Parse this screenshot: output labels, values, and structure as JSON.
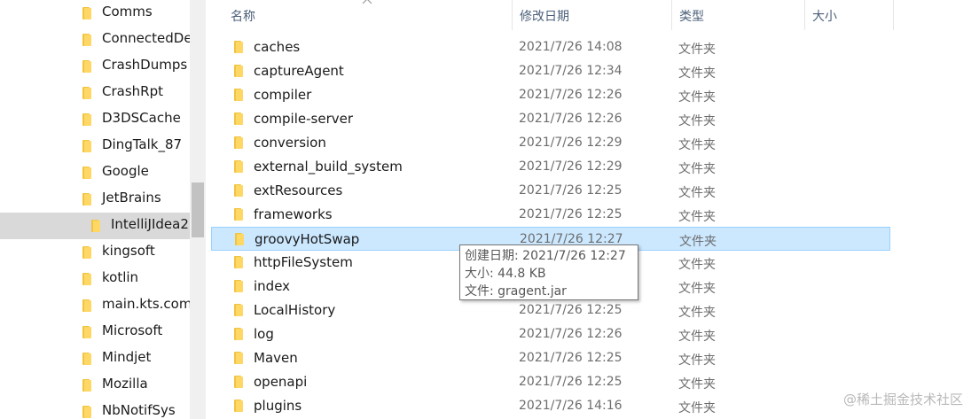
{
  "nav": {
    "items": [
      {
        "label": "Comms",
        "selected": false,
        "child": false
      },
      {
        "label": "ConnectedDe",
        "selected": false,
        "child": false
      },
      {
        "label": "CrashDumps",
        "selected": false,
        "child": false
      },
      {
        "label": "CrashRpt",
        "selected": false,
        "child": false
      },
      {
        "label": "D3DSCache",
        "selected": false,
        "child": false
      },
      {
        "label": "DingTalk_87",
        "selected": false,
        "child": false
      },
      {
        "label": "Google",
        "selected": false,
        "child": false
      },
      {
        "label": "JetBrains",
        "selected": false,
        "child": false
      },
      {
        "label": "IntelliJIdea2",
        "selected": true,
        "child": true
      },
      {
        "label": "kingsoft",
        "selected": false,
        "child": false
      },
      {
        "label": "kotlin",
        "selected": false,
        "child": false
      },
      {
        "label": "main.kts.com",
        "selected": false,
        "child": false
      },
      {
        "label": "Microsoft",
        "selected": false,
        "child": false
      },
      {
        "label": "Mindjet",
        "selected": false,
        "child": false
      },
      {
        "label": "Mozilla",
        "selected": false,
        "child": false
      },
      {
        "label": "NbNotifSys",
        "selected": false,
        "child": false
      }
    ]
  },
  "columns": {
    "name": "名称",
    "modified": "修改日期",
    "type": "类型",
    "size": "大小"
  },
  "files": [
    {
      "name": "caches",
      "modified": "2021/7/26 14:08",
      "type": "文件夹"
    },
    {
      "name": "captureAgent",
      "modified": "2021/7/26 12:34",
      "type": "文件夹"
    },
    {
      "name": "compiler",
      "modified": "2021/7/26 12:26",
      "type": "文件夹"
    },
    {
      "name": "compile-server",
      "modified": "2021/7/26 12:26",
      "type": "文件夹"
    },
    {
      "name": "conversion",
      "modified": "2021/7/26 12:29",
      "type": "文件夹"
    },
    {
      "name": "external_build_system",
      "modified": "2021/7/26 12:29",
      "type": "文件夹"
    },
    {
      "name": "extResources",
      "modified": "2021/7/26 12:25",
      "type": "文件夹"
    },
    {
      "name": "frameworks",
      "modified": "2021/7/26 12:25",
      "type": "文件夹"
    },
    {
      "name": "groovyHotSwap",
      "modified": "2021/7/26 12:27",
      "type": "文件夹",
      "hover": true
    },
    {
      "name": "httpFileSystem",
      "modified": "",
      "type": "文件夹"
    },
    {
      "name": "index",
      "modified": "",
      "type": "文件夹"
    },
    {
      "name": "LocalHistory",
      "modified": "2021/7/26 12:25",
      "type": "文件夹"
    },
    {
      "name": "log",
      "modified": "2021/7/26 12:26",
      "type": "文件夹"
    },
    {
      "name": "Maven",
      "modified": "2021/7/26 12:25",
      "type": "文件夹"
    },
    {
      "name": "openapi",
      "modified": "2021/7/26 12:25",
      "type": "文件夹"
    },
    {
      "name": "plugins",
      "modified": "2021/7/26 14:16",
      "type": "文件夹"
    }
  ],
  "tooltip": {
    "created": "创建日期: 2021/7/26 12:27",
    "size": "大小: 44.8 KB",
    "file": "文件: gragent.jar"
  },
  "watermark": "@稀土掘金技术社区",
  "icons": {
    "folder": "folder-icon",
    "sort": "sort-up-arrow-icon"
  },
  "colors": {
    "hover_row": "#cce8ff",
    "selected_nav": "#d9d9d9",
    "folder": "#ffd765",
    "header_text": "#4c607a"
  }
}
